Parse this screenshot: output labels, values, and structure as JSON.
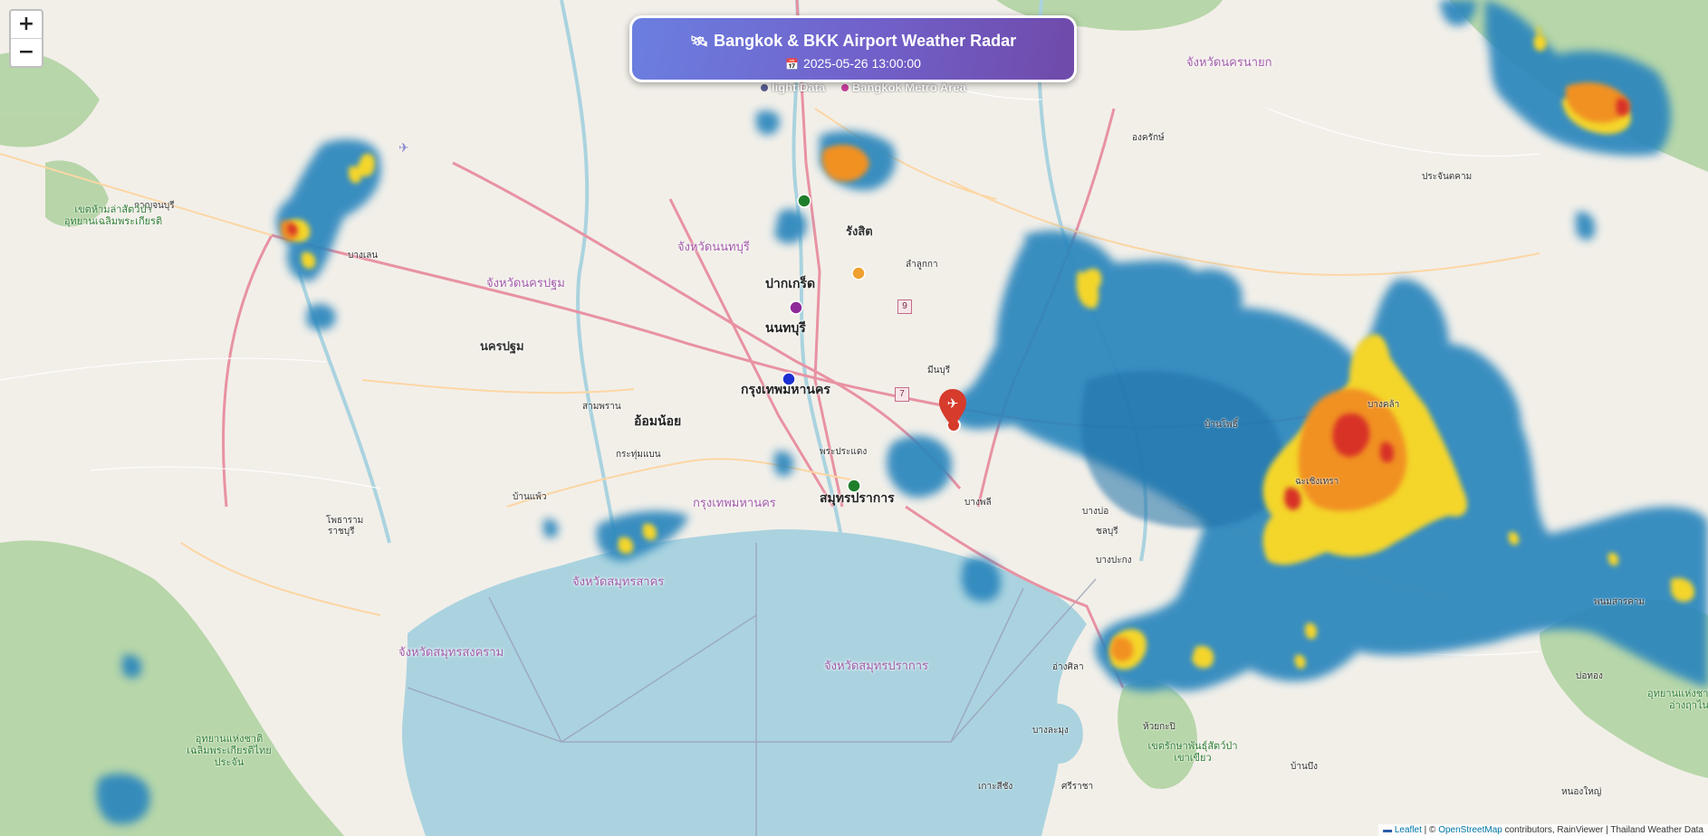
{
  "header": {
    "icon": "satellite-icon",
    "title": "Bangkok & BKK Airport Weather Radar",
    "date_icon": "calendar-icon",
    "datetime": "2025-05-26 13:00:00"
  },
  "legend_overlay": {
    "item1": "light Data",
    "item2": "Bangkok Metro Area"
  },
  "zoom": {
    "in": "+",
    "out": "−"
  },
  "attribution": {
    "leaflet": "Leaflet",
    "sep": " | © ",
    "osm": "OpenStreetMap",
    "rest": " contributors, RainViewer | Thailand Weather Data"
  },
  "colors": {
    "sea": "#aad3df",
    "land": "#f2efe9",
    "forest": "#add19e",
    "radar_light": "#2e8fc2",
    "radar_dark": "#1f5f99",
    "radar_yellow": "#f7e128",
    "radar_orange": "#f39a1e",
    "radar_red": "#d9302a",
    "airport_marker": "#d63b2c"
  },
  "map_labels": [
    {
      "id": "bangkok",
      "text": "กรุงเทพมหานคร",
      "style": "city"
    },
    {
      "id": "nonthaburi",
      "text": "นนทบุรี",
      "style": "city"
    },
    {
      "id": "pakkret",
      "text": "ปากเกร็ด",
      "style": "city"
    },
    {
      "id": "rangsit",
      "text": "รังสิต",
      "style": "town"
    },
    {
      "id": "samutprakan",
      "text": "สมุทรปราการ",
      "style": "city"
    },
    {
      "id": "omnoi",
      "text": "อ้อมน้อย",
      "style": "city"
    },
    {
      "id": "nakhonpathom",
      "text": "นครปฐม",
      "style": "town"
    },
    {
      "id": "prov_nonthaburi",
      "text": "จังหวัดนนทบุรี",
      "style": "province"
    },
    {
      "id": "prov_nakhonpathom",
      "text": "จังหวัดนครปฐม",
      "style": "province"
    },
    {
      "id": "prov_bangkok",
      "text": "กรุงเทพมหานคร",
      "style": "province"
    },
    {
      "id": "prov_samutsakhon",
      "text": "จังหวัดสมุทรสาคร",
      "style": "province"
    },
    {
      "id": "prov_samutsongkhram",
      "text": "จังหวัดสมุทรสงคราม",
      "style": "province"
    },
    {
      "id": "prov_samutprakan",
      "text": "จังหวัดสมุทรปราการ",
      "style": "province"
    },
    {
      "id": "prov_nakhonnayok",
      "text": "จังหวัดนครนายก",
      "style": "province"
    },
    {
      "id": "kanchana",
      "text": "กาญจนบุรี",
      "style": "small"
    },
    {
      "id": "chachoengsao",
      "text": "ฉะเชิงเทรา",
      "style": "small"
    },
    {
      "id": "banglen",
      "text": "บางเลน",
      "style": "small"
    },
    {
      "id": "lamlukka",
      "text": "ลำลูกกา",
      "style": "small"
    },
    {
      "id": "minburi",
      "text": "มีนบุรี",
      "style": "small"
    },
    {
      "id": "bangplee",
      "text": "บางพลี",
      "style": "small"
    },
    {
      "id": "phrapradaeng",
      "text": "พระประแดง",
      "style": "small"
    },
    {
      "id": "krathumbaen",
      "text": "กระทุ่มแบน",
      "style": "small"
    },
    {
      "id": "bangbo",
      "text": "บางบ่อ",
      "style": "small"
    },
    {
      "id": "bangpakong",
      "text": "บางปะกง",
      "style": "small"
    },
    {
      "id": "chonburi",
      "text": "ชลบุรี",
      "style": "small"
    },
    {
      "id": "ongkharak",
      "text": "องครักษ์",
      "style": "small"
    },
    {
      "id": "prachinburi",
      "text": "ประจันตคาม",
      "style": "small"
    },
    {
      "id": "bangkhla",
      "text": "บางคล้า",
      "style": "small"
    },
    {
      "id": "phanomsarakham",
      "text": "พนมสารคาม",
      "style": "small"
    },
    {
      "id": "banpho",
      "text": "บ้านโพธิ์",
      "style": "small"
    },
    {
      "id": "samphran",
      "text": "สามพราน",
      "style": "small"
    },
    {
      "id": "banpaeo",
      "text": "บ้านแพ้ว",
      "style": "small"
    },
    {
      "id": "photharam",
      "text": "โพธาราม",
      "style": "small"
    },
    {
      "id": "ratchaburi",
      "text": "ราชบุรี",
      "style": "small"
    },
    {
      "id": "sriracha",
      "text": "ศรีราชา",
      "style": "small"
    },
    {
      "id": "banglamung",
      "text": "บางละมุง",
      "style": "small"
    },
    {
      "id": "nongyai",
      "text": "หนองใหญ่",
      "style": "small"
    },
    {
      "id": "bobong",
      "text": "บ่อทอง",
      "style": "small"
    },
    {
      "id": "kohsichang",
      "text": "เกาะสีชัง",
      "style": "small"
    },
    {
      "id": "angsila",
      "text": "อ่างศิลา",
      "style": "small"
    },
    {
      "id": "huaikapi",
      "text": "ห้วยกะปิ",
      "style": "small"
    },
    {
      "id": "banbueng",
      "text": "บ้านบึง",
      "style": "small"
    },
    {
      "id": "park_west",
      "text": "อุทยานแห่งชาติเฉลิมพระเกียรติไทยประจัน",
      "style": "park"
    },
    {
      "id": "park_east",
      "text": "อุทยานแห่งชาติเขาอ่างฤาไน",
      "style": "park"
    },
    {
      "id": "park_khaokheow",
      "text": "เขตรักษาพันธุ์สัตว์ป่าเขาเขียว",
      "style": "park"
    },
    {
      "id": "park_north",
      "text": "เขตห้ามล่าสัตว์ป่าอุทยานเฉลิมพระเกียรติ",
      "style": "park"
    }
  ],
  "road_shields": [
    {
      "id": "r9",
      "text": "9"
    },
    {
      "id": "r7",
      "text": "7"
    }
  ]
}
